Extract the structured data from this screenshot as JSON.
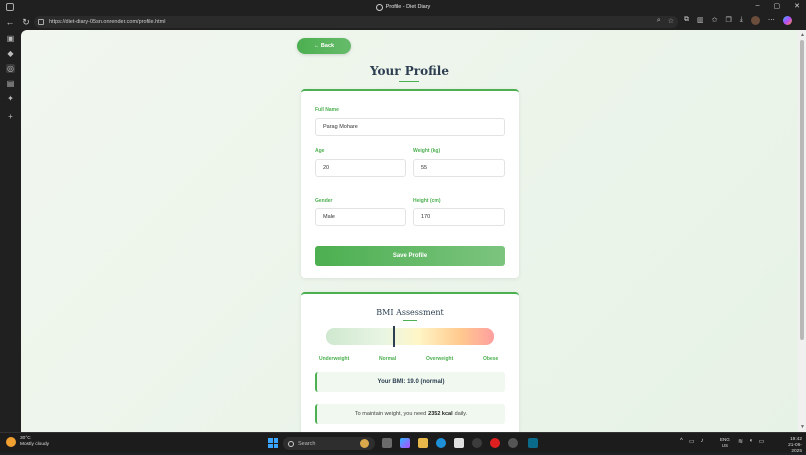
{
  "window": {
    "title": "Profile - Diet Diary"
  },
  "browser": {
    "url": "https://diet-diary-05sn.onrender.com/profile.html"
  },
  "page": {
    "back_label": "← Back",
    "title": "Your Profile"
  },
  "profile": {
    "full_name_label": "Full Name",
    "full_name_value": "Parag Mohare",
    "age_label": "Age",
    "age_value": "20",
    "weight_label": "Weight (kg)",
    "weight_value": "55",
    "gender_label": "Gender",
    "gender_value": "Male",
    "height_label": "Height (cm)",
    "height_value": "170",
    "save_label": "Save Profile"
  },
  "bmi": {
    "title": "BMI Assessment",
    "categories": [
      "Underweight",
      "Normal",
      "Overweight",
      "Obese"
    ],
    "marker_position_fraction": 0.4,
    "result_text": "Your BMI: 19.0 (normal)",
    "advice_prefix": "To maintain weight, you need",
    "advice_kcal": "2352 kcal",
    "advice_suffix": "daily."
  },
  "taskbar": {
    "weather_temp": "30°C",
    "weather_desc": "Mostly cloudy",
    "search_label": "Search",
    "lang_line1": "ENG",
    "lang_line2": "US",
    "time": "19:42",
    "date": "21-06-2025"
  }
}
